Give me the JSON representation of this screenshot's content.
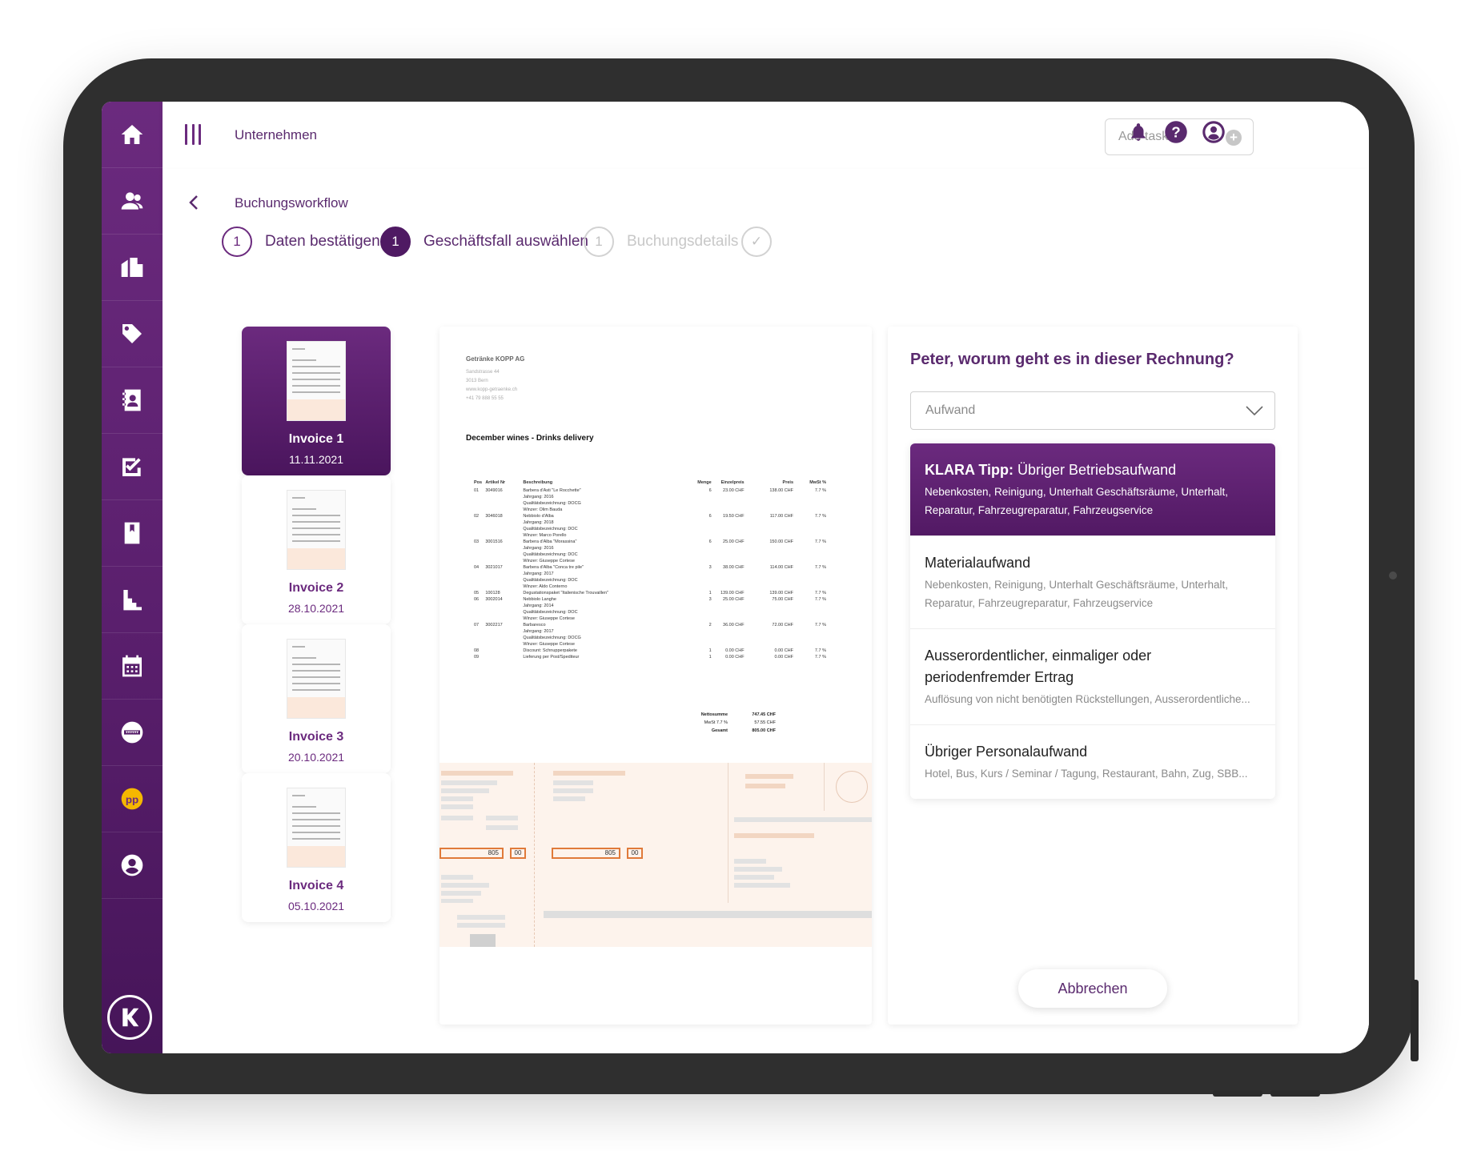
{
  "topbar": {
    "title": "Unternehmen",
    "add_task_placeholder": "Add task..."
  },
  "subbar": {
    "title": "Buchungsworkflow"
  },
  "sidebar": {
    "items": [
      "home-icon",
      "users-icon",
      "buildings-icon",
      "tag-icon",
      "contacts-book-icon",
      "tasks-edit-icon",
      "bookmark-icon",
      "chart-stairs-icon",
      "calendar-icon",
      "globe-icon",
      "pp-coin-icon",
      "profile-icon"
    ],
    "logo": "K"
  },
  "stepper": {
    "steps": [
      {
        "number": "1",
        "label": "Daten bestätigen",
        "state": "done"
      },
      {
        "number": "1",
        "label": "Geschäftsfall auswählen",
        "state": "active"
      },
      {
        "number": "1",
        "label": "Buchungsdetails",
        "state": "disabled"
      },
      {
        "number": "✓",
        "label": "",
        "state": "disabled"
      }
    ]
  },
  "invoices": [
    {
      "name": "Invoice 1",
      "date": "11.11.2021"
    },
    {
      "name": "Invoice 2",
      "date": "28.10.2021"
    },
    {
      "name": "Invoice 3",
      "date": "20.10.2021"
    },
    {
      "name": "Invoice 4",
      "date": "05.10.2021"
    }
  ],
  "document": {
    "company": "Getränke KOPP AG",
    "address": [
      "Sandstrasse 44",
      "3013 Bern",
      "www.kopp-getraenke.ch",
      "+41 79 888 55 55"
    ],
    "title": "December wines - Drinks delivery",
    "headers": [
      "Pos",
      "Artikel Nr",
      "Beschreibung",
      "Menge",
      "Einzelpreis",
      "Preis",
      "MwSt %"
    ],
    "rows": [
      [
        "01",
        "3049016",
        "Barbera d'Asti \"Le Rocchette\"",
        "6",
        "23.00 CHF",
        "138.00 CHF",
        "7.7 %"
      ],
      [
        "",
        "",
        "Jahrgang: 2016",
        "",
        "",
        "",
        ""
      ],
      [
        "",
        "",
        "Qualitätsbezeichnung: DOCG",
        "",
        "",
        "",
        ""
      ],
      [
        "",
        "",
        "Winzer: Olim Bauda",
        "",
        "",
        "",
        ""
      ],
      [
        "02",
        "3046018",
        "Nebbiolo d'Alba",
        "6",
        "19.50 CHF",
        "117.00 CHF",
        "7.7 %"
      ],
      [
        "",
        "",
        "Jahrgang: 2018",
        "",
        "",
        "",
        ""
      ],
      [
        "",
        "",
        "Qualitätsbezeichnung: DOC",
        "",
        "",
        "",
        ""
      ],
      [
        "",
        "",
        "Winzer: Marco Porello",
        "",
        "",
        "",
        ""
      ],
      [
        "03",
        "3001516",
        "Barbera d'Alba \"Morassina\"",
        "6",
        "25.00 CHF",
        "150.00 CHF",
        "7.7 %"
      ],
      [
        "",
        "",
        "Jahrgang: 2016",
        "",
        "",
        "",
        ""
      ],
      [
        "",
        "",
        "Qualitätsbezeichnung: DOC",
        "",
        "",
        "",
        ""
      ],
      [
        "",
        "",
        "Winzer: Giuseppe Cortese",
        "",
        "",
        "",
        ""
      ],
      [
        "04",
        "3021017",
        "Barbera d'Alba \"Conca tre pile\"",
        "3",
        "38.00 CHF",
        "114.00 CHF",
        "7.7 %"
      ],
      [
        "",
        "",
        "Jahrgang: 2017",
        "",
        "",
        "",
        ""
      ],
      [
        "",
        "",
        "Qualitätsbezeichnung: DOC",
        "",
        "",
        "",
        ""
      ],
      [
        "",
        "",
        "Winzer: Aldo Conterno",
        "",
        "",
        "",
        ""
      ],
      [
        "05",
        "100128",
        "Degustationspaket \"Italienische Trouvaillen\"",
        "1",
        "139.00 CHF",
        "139.00 CHF",
        "7.7 %"
      ],
      [
        "06",
        "3002014",
        "Nebbiolo Langhe",
        "3",
        "25.00 CHF",
        "75.00 CHF",
        "7.7 %"
      ],
      [
        "",
        "",
        "Jahrgang: 2014",
        "",
        "",
        "",
        ""
      ],
      [
        "",
        "",
        "Qualitätsbezeichnung: DOC",
        "",
        "",
        "",
        ""
      ],
      [
        "",
        "",
        "Winzer: Giuseppe Cortese",
        "",
        "",
        "",
        ""
      ],
      [
        "07",
        "3002217",
        "Barbaresco",
        "2",
        "36.00 CHF",
        "72.00 CHF",
        "7.7 %"
      ],
      [
        "",
        "",
        "Jahrgang: 2017",
        "",
        "",
        "",
        ""
      ],
      [
        "",
        "",
        "Qualitätsbezeichnung: DOCG",
        "",
        "",
        "",
        ""
      ],
      [
        "",
        "",
        "Winzer: Giuseppe Cortese",
        "",
        "",
        "",
        ""
      ],
      [
        "08",
        "",
        "Discount: Schnupperpakete",
        "1",
        "0.00 CHF",
        "0.00 CHF",
        "7.7 %"
      ],
      [
        "09",
        "",
        "Lieferung per Post/Spediteur",
        "1",
        "0.00 CHF",
        "0.00 CHF",
        "7.7 %"
      ]
    ],
    "sums": [
      {
        "label": "Nettosumme",
        "value": "747.45 CHF"
      },
      {
        "label": "MwSt 7.7 %",
        "value": "57.55 CHF"
      },
      {
        "label": "Gesamt",
        "value": "805.00 CHF"
      }
    ],
    "slip_amount": "805",
    "slip_cents": "00"
  },
  "panel": {
    "question": "Peter, worum geht es in dieser Rechnung?",
    "select_value": "Aufwand",
    "tip_prefix": "KLARA Tipp:",
    "options": [
      {
        "title": "Übriger Betriebsaufwand",
        "desc": "Nebenkosten, Reinigung, Unterhalt Geschäftsräume, Unterhalt, Reparatur, Fahrzeugreparatur, Fahrzeugservice"
      },
      {
        "title": "Materialaufwand",
        "desc": "Nebenkosten, Reinigung, Unterhalt Geschäftsräume, Unterhalt, Reparatur, Fahrzeugreparatur, Fahrzeugservice"
      },
      {
        "title": "Ausserordentlicher, einmaliger oder periodenfremder Ertrag",
        "desc": "Auflösung von nicht benötigten Rückstellungen, Ausserordentliche..."
      },
      {
        "title": "Übriger Personalaufwand",
        "desc": "Hotel, Bus, Kurs / Seminar / Tagung, Restaurant, Bahn, Zug, SBB..."
      }
    ],
    "cancel_label": "Abbrechen"
  },
  "colors": {
    "brand": "#6b2a7e",
    "brand_dark": "#4f1a63",
    "slip_orange": "#e07a3a"
  }
}
